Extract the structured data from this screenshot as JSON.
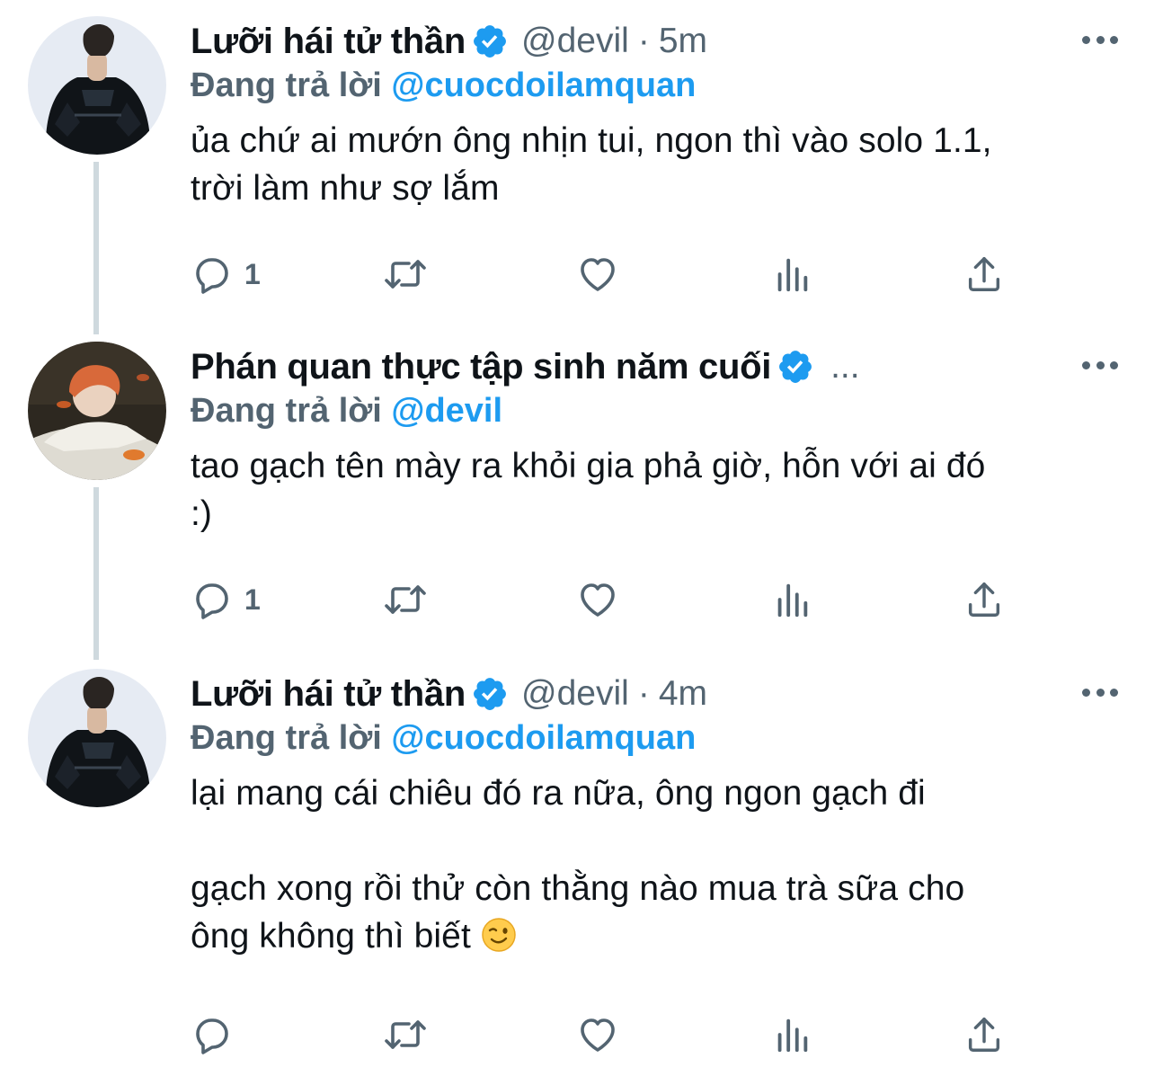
{
  "icons": {
    "reply": "speech-bubble-icon",
    "retweet": "retweet-arrows-icon",
    "like": "heart-icon",
    "analytics": "bar-chart-icon",
    "share": "share-upload-icon",
    "more": "more-horizontal-icon",
    "verified": "verified-badge-icon"
  },
  "colors": {
    "accent": "#1d9bf0",
    "secondary_text": "#536471",
    "thread_line": "#cfd9de"
  },
  "tweets": [
    {
      "display_name": "Lưỡi hái tử thần",
      "verified": true,
      "handle": "@devil",
      "separator": "·",
      "time": "5m",
      "replying_prefix": "Đang trả lời",
      "replying_to": "@cuocdoilamquan",
      "text": "ủa chứ ai mướn ông nhịn tui, ngon thì vào solo 1.1,\ntrời làm như sợ lắm",
      "reply_count": "1"
    },
    {
      "display_name": "Phán quan thực tập sinh năm cuối",
      "verified": true,
      "truncated": "...",
      "replying_prefix": "Đang trả lời",
      "replying_to": "@devil",
      "text": "tao gạch tên mày ra khỏi gia phả giờ, hỗn với ai đó\n:)",
      "reply_count": "1"
    },
    {
      "display_name": "Lưỡi hái tử thần",
      "verified": true,
      "handle": "@devil",
      "separator": "·",
      "time": "4m",
      "replying_prefix": "Đang trả lời",
      "replying_to": "@cuocdoilamquan",
      "text_line1": "lại mang cái chiêu đó ra nữa, ông ngon gạch đi",
      "text_line2": "gạch xong rồi thử còn thằng nào mua trà sữa cho\nông không thì biết",
      "emoji": "winking-face-emoji",
      "reply_count": ""
    }
  ]
}
